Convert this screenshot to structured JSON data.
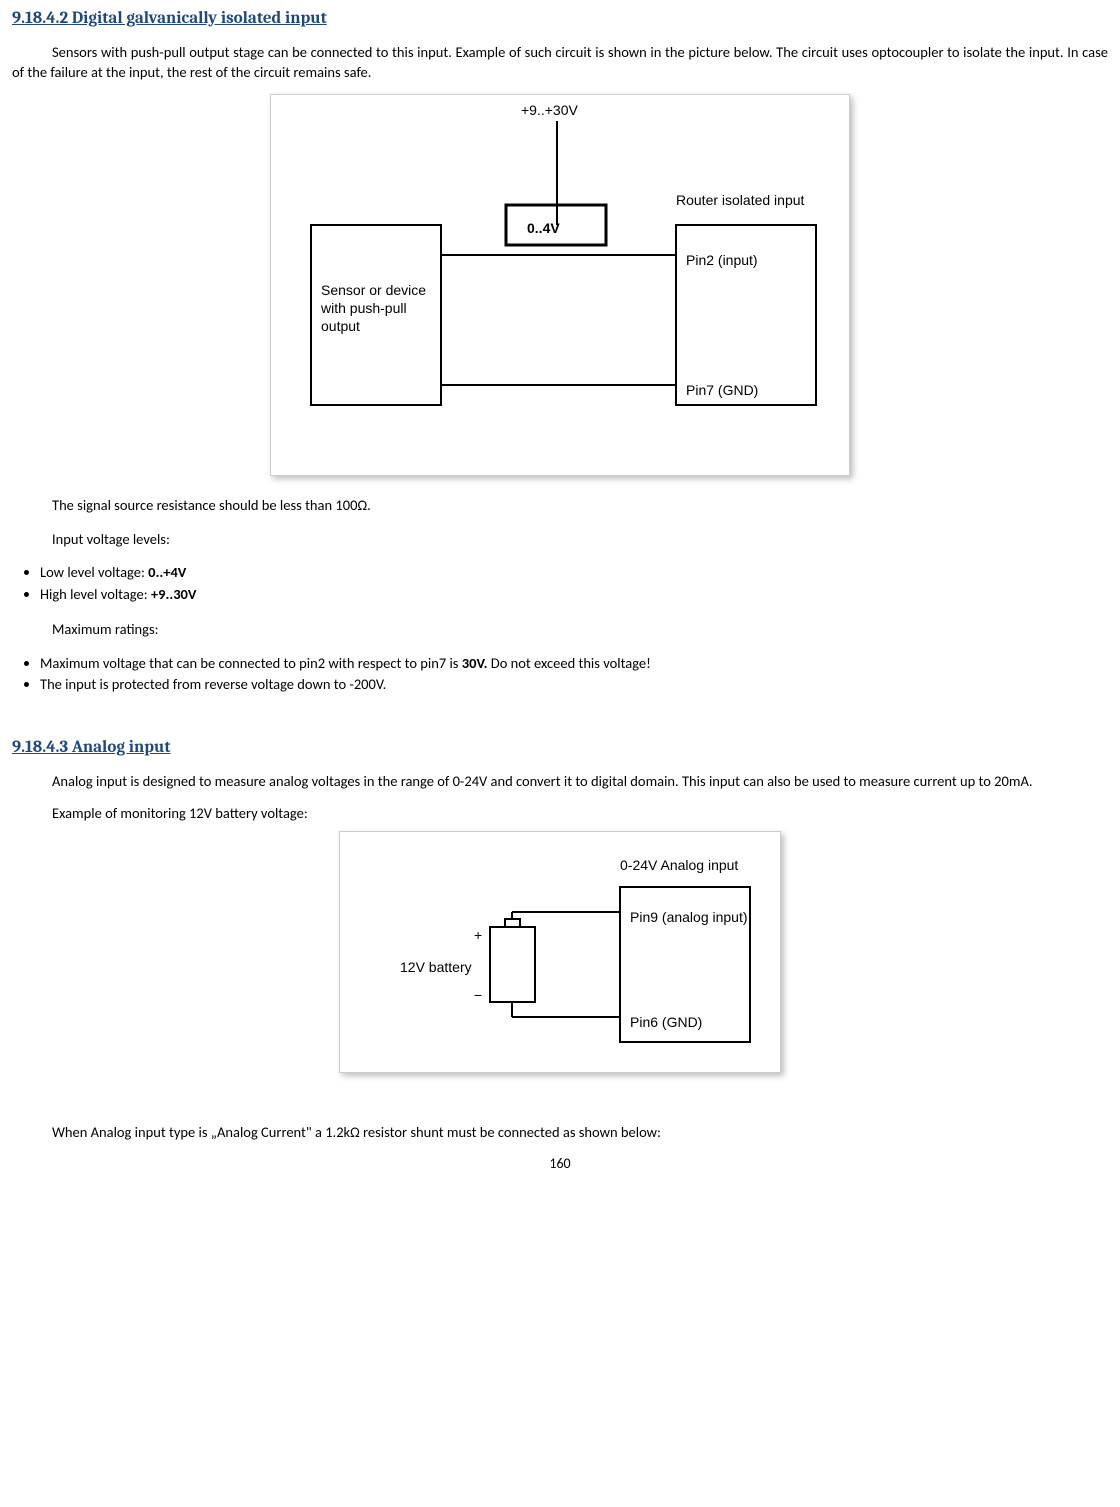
{
  "section1": {
    "number": "9.18.4.2",
    "title": "Digital galvanically isolated input",
    "para1": "Sensors with push-pull output stage can be connected to this input.  Example of such circuit is shown in the picture  below. The circuit uses optocoupler to isolate the input. In case of the failure at the input, the rest of the circuit remains safe.",
    "afterfig1": "The signal source resistance should be less than 100Ω.",
    "levels_label": "Input voltage levels:",
    "low_label": "Low level voltage:  ",
    "low_val": "0..+4V",
    "high_label": "High level voltage:  ",
    "high_val": "+9..30V",
    "max_label": "Maximum ratings:",
    "max1_pre": "Maximum voltage that can be connected to pin2 with respect to pin7 is ",
    "max1_bold": "30V.",
    "max1_post": "  Do not exceed this voltage!",
    "max2": "The input is protected from reverse voltage down to -200V."
  },
  "fig1": {
    "top_label": "+9..+30V",
    "left_label_l1": "Sensor or device",
    "left_label_l2": "with push-pull",
    "left_label_l3": "output",
    "mid_label": "0..4V",
    "right_title": "Router isolated input",
    "pin_in": "Pin2 (input)",
    "pin_gnd": "Pin7 (GND)"
  },
  "section2": {
    "number": "9.18.4.3",
    "title": "Analog input",
    "para1": "Analog input is designed to measure analog voltages in the range of 0-24V and convert it to digital domain. This input can also be used to measure current up to 20mA.",
    "para2": "Example of monitoring 12V battery voltage:",
    "para3": "When Analog input type is „Analog Current\" a 1.2kΩ resistor shunt must be connected as shown below:"
  },
  "fig2": {
    "right_title": "0-24V Analog input",
    "pin_in": "Pin9 (analog input)",
    "pin_gnd": "Pin6 (GND)",
    "batt_label": "12V battery",
    "plus": "+",
    "minus": "−"
  },
  "page_number": "160"
}
